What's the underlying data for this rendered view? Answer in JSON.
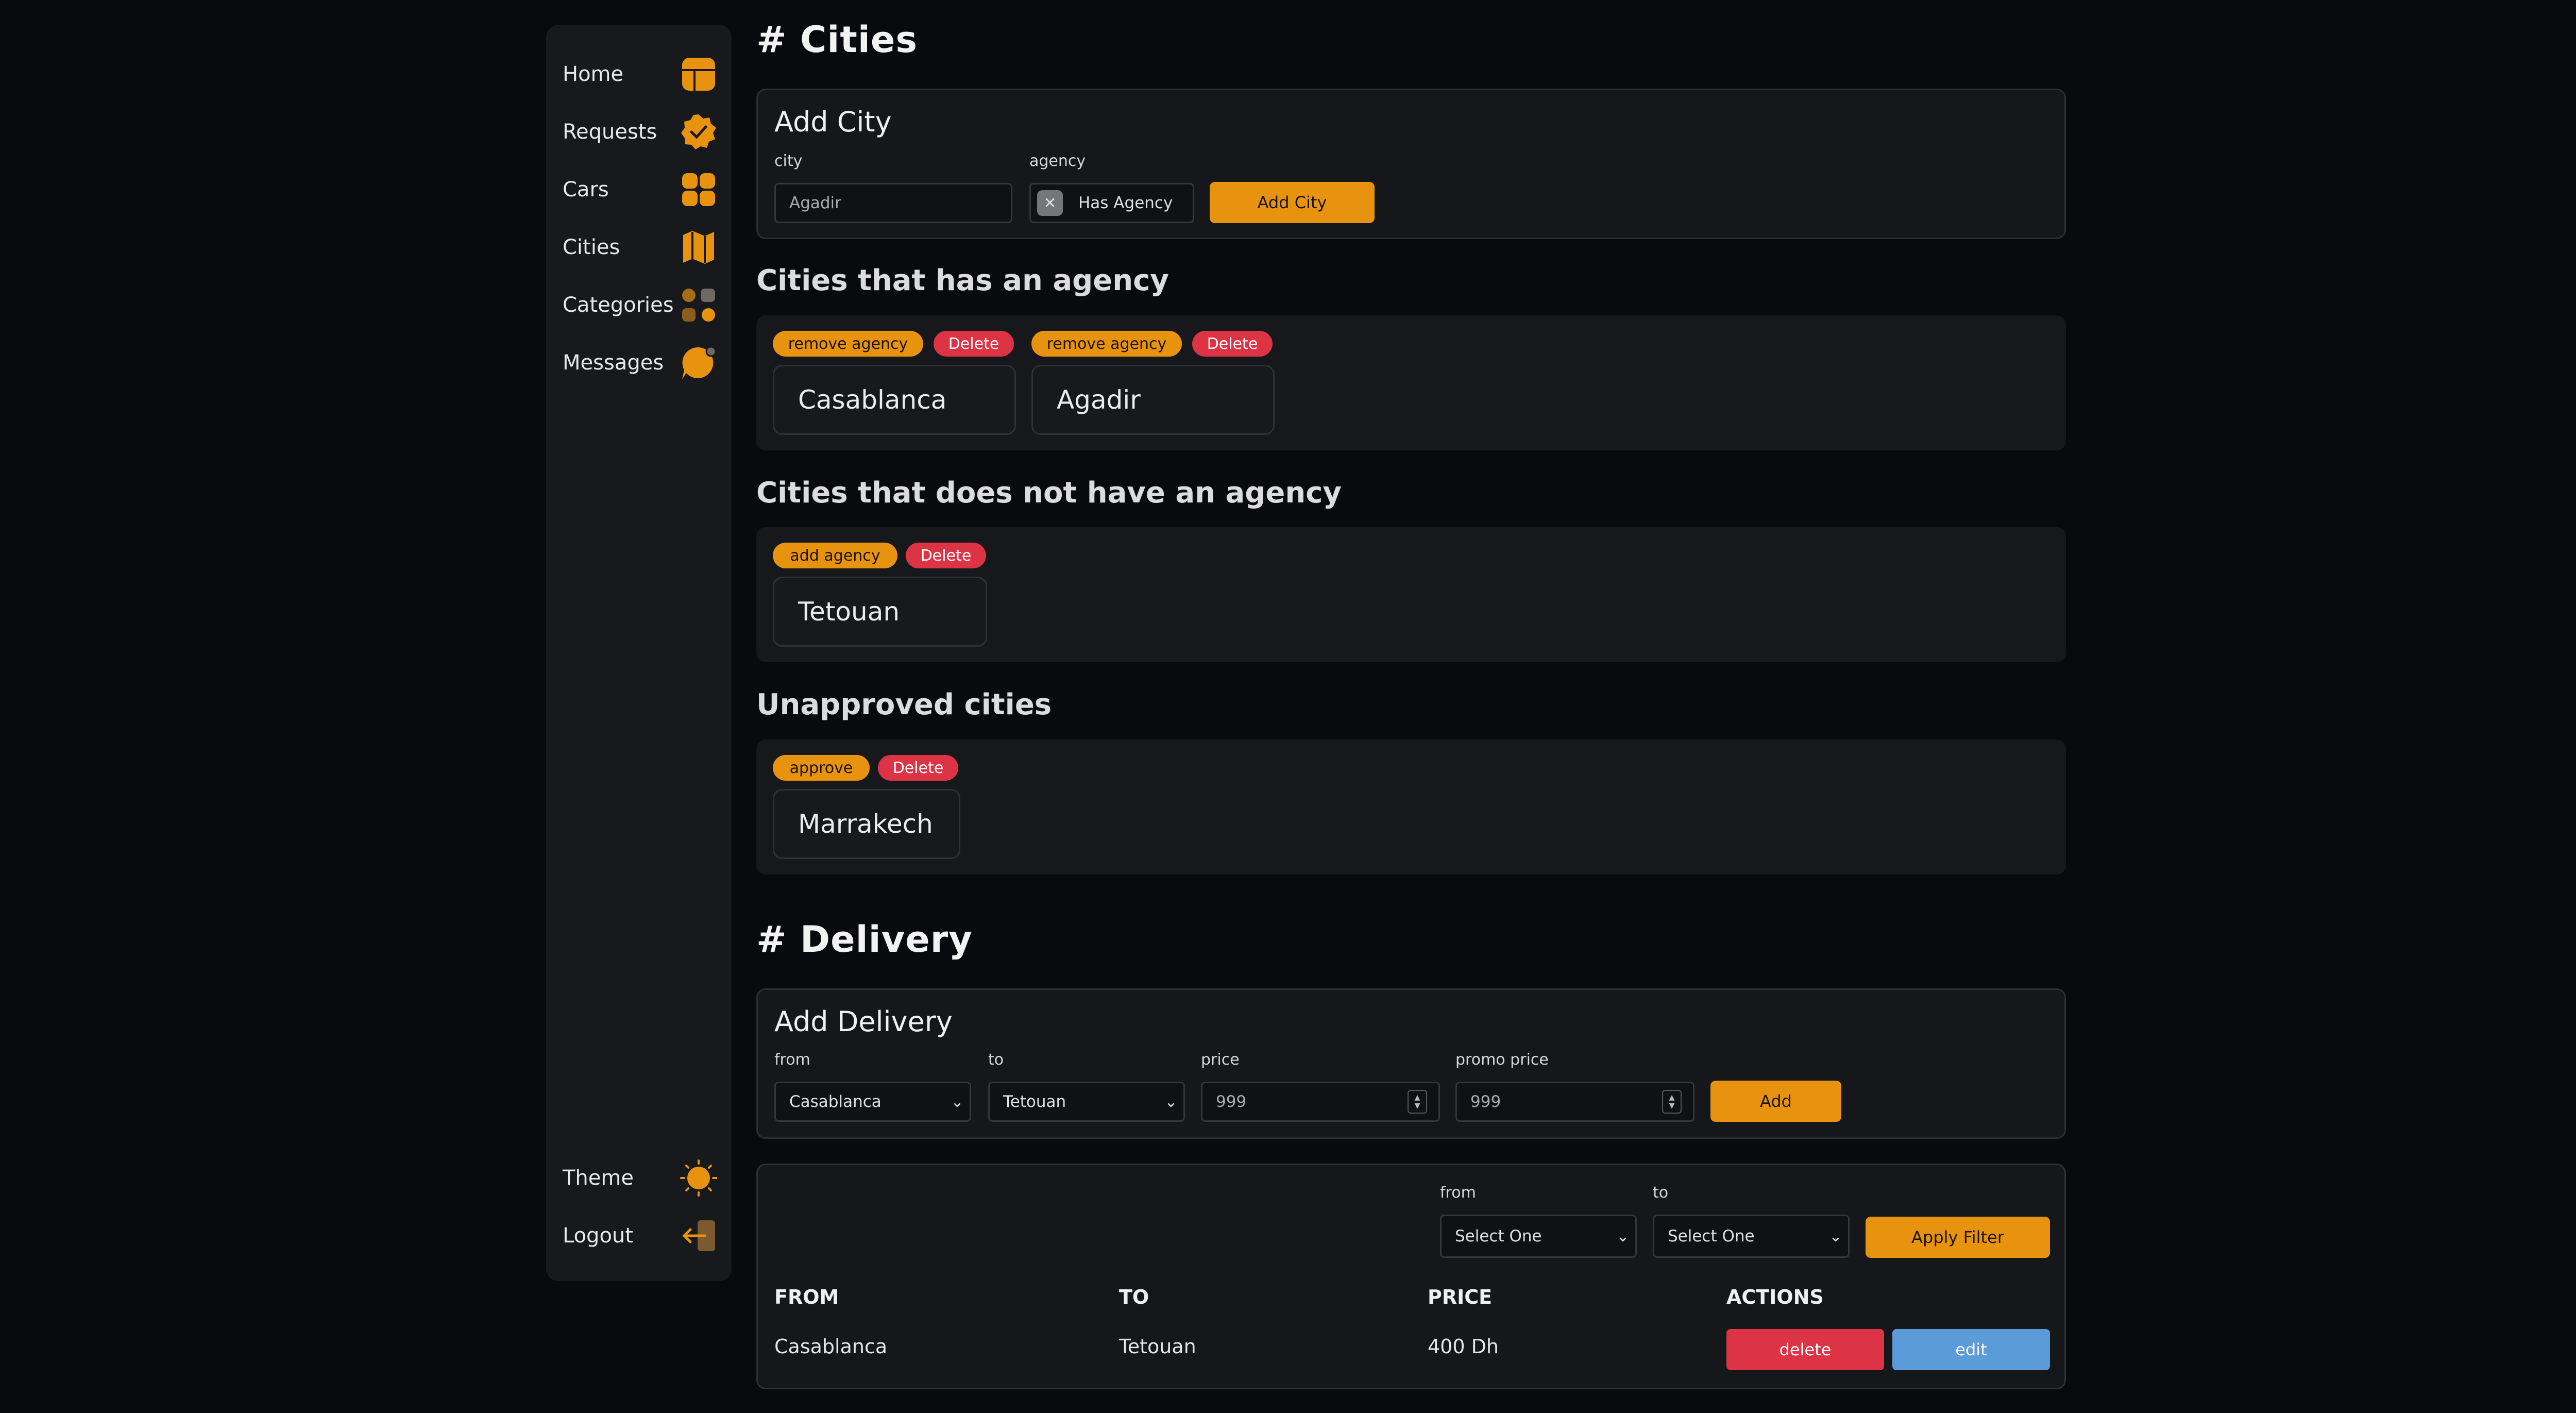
{
  "sidebar": {
    "items": [
      {
        "label": "Home",
        "icon": "home-icon"
      },
      {
        "label": "Requests",
        "icon": "verified-badge-icon"
      },
      {
        "label": "Cars",
        "icon": "grid-icon"
      },
      {
        "label": "Cities",
        "icon": "map-icon"
      },
      {
        "label": "Categories",
        "icon": "categories-icon"
      },
      {
        "label": "Messages",
        "icon": "chat-bubble-icon"
      }
    ],
    "bottom": [
      {
        "label": "Theme",
        "icon": "sun-icon"
      },
      {
        "label": "Logout",
        "icon": "logout-icon"
      }
    ]
  },
  "cities_section": {
    "heading": "# Cities",
    "add": {
      "title": "Add City",
      "city_label": "city",
      "city_value": "Agadir",
      "agency_label": "agency",
      "agency_chip": "Has Agency",
      "button": "Add City"
    },
    "with_agency": {
      "heading": "Cities that has an agency",
      "action": "remove agency",
      "delete": "Delete",
      "cities": [
        "Casablanca",
        "Agadir"
      ]
    },
    "without_agency": {
      "heading": "Cities that does not have an agency",
      "action": "add agency",
      "delete": "Delete",
      "cities": [
        "Tetouan"
      ]
    },
    "unapproved": {
      "heading": "Unapproved cities",
      "action": "approve",
      "delete": "Delete",
      "cities": [
        "Marrakech"
      ]
    }
  },
  "delivery_section": {
    "heading": "# Delivery",
    "add": {
      "title": "Add Delivery",
      "from_label": "from",
      "from_value": "Casablanca",
      "to_label": "to",
      "to_value": "Tetouan",
      "price_label": "price",
      "price_value": "999",
      "promo_label": "promo price",
      "promo_value": "999",
      "button": "Add"
    },
    "filter": {
      "from_label": "from",
      "from_value": "Select One",
      "to_label": "to",
      "to_value": "Select One",
      "button": "Apply Filter"
    },
    "table": {
      "headers": [
        "FROM",
        "TO",
        "PRICE",
        "ACTIONS"
      ],
      "rows": [
        {
          "from": "Casablanca",
          "to": "Tetouan",
          "price": "400 Dh",
          "delete": "delete",
          "edit": "edit"
        }
      ]
    }
  },
  "colors": {
    "accent": "#e8930f",
    "danger": "#dc3345",
    "info": "#5a9bd8",
    "background": "#080a0e",
    "panel": "#16181c"
  }
}
